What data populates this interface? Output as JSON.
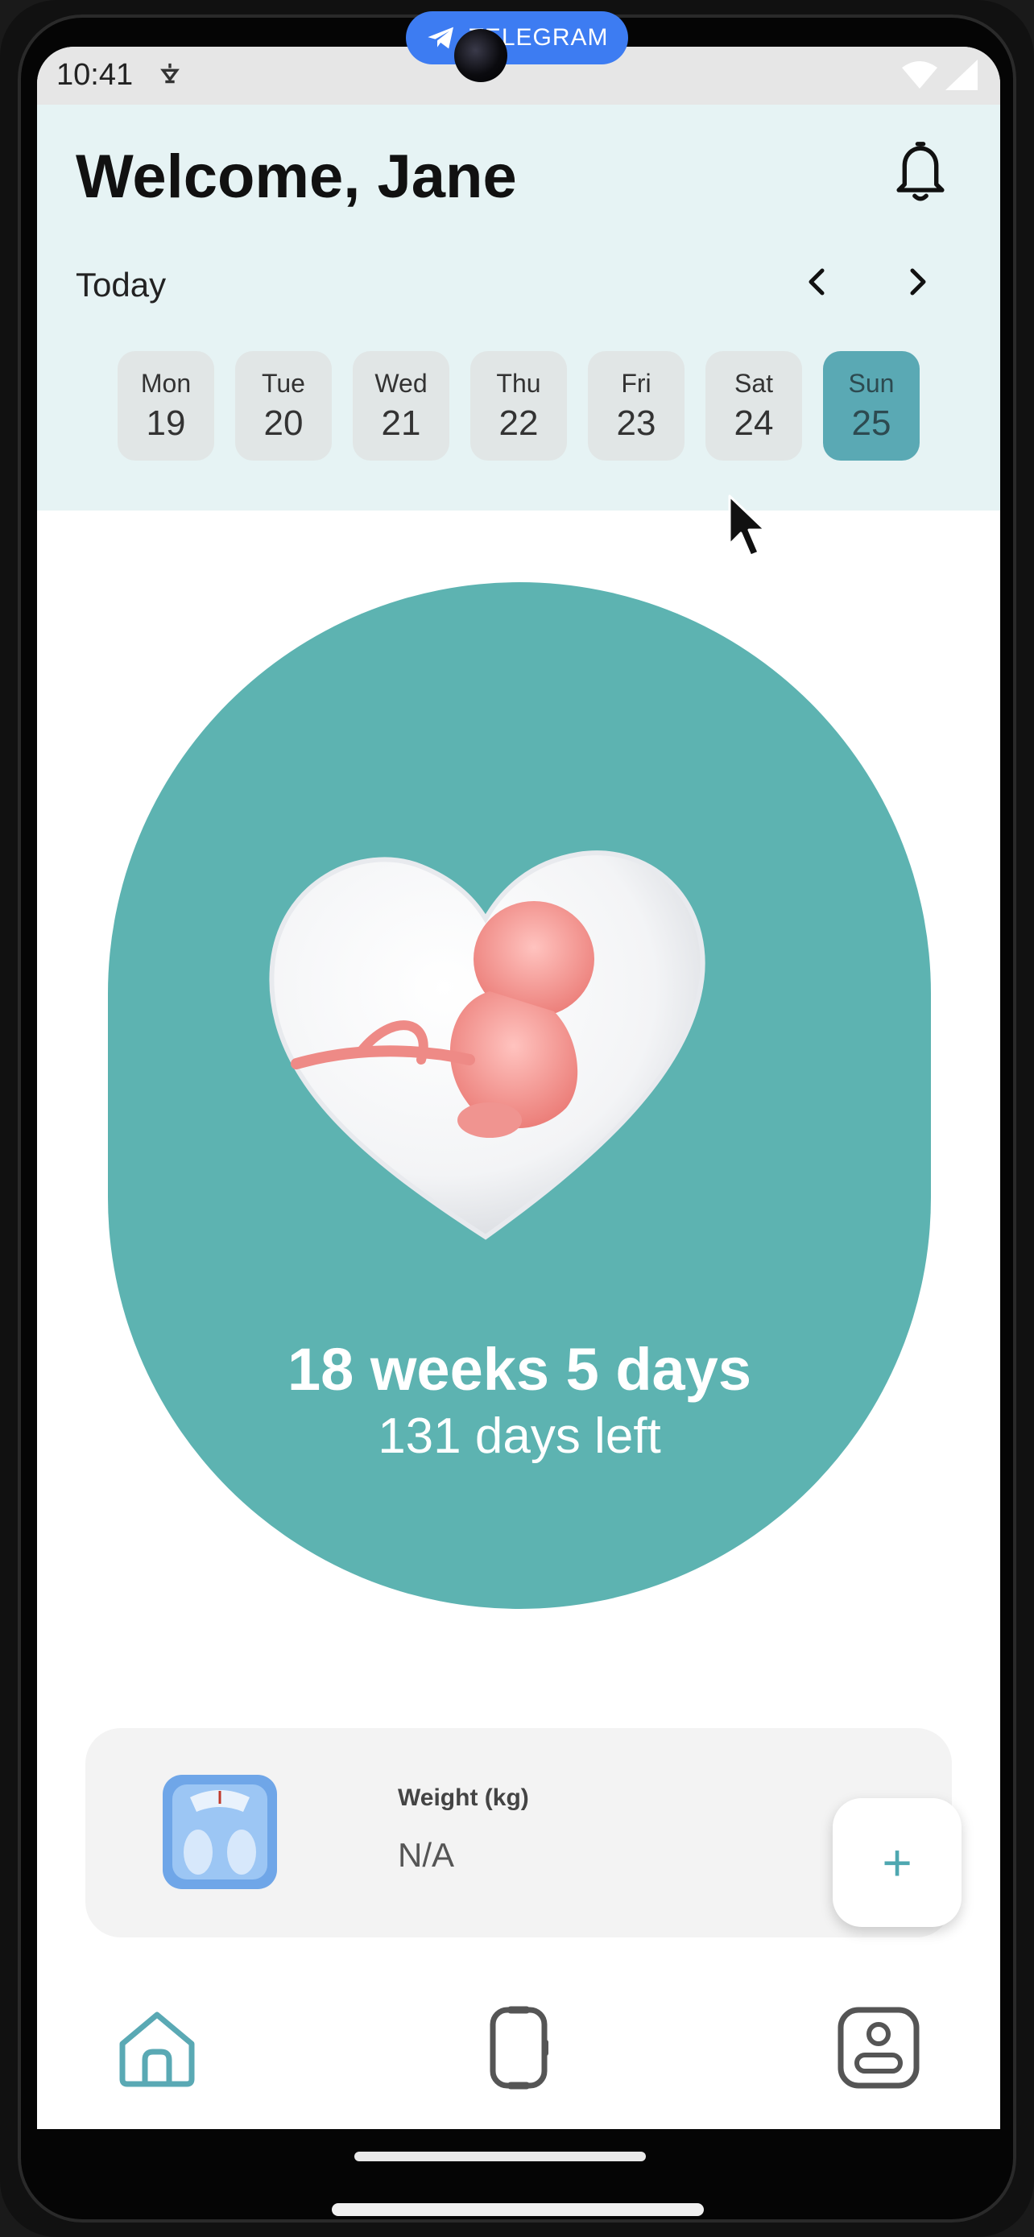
{
  "overlay": {
    "telegram_label": "TELEGRAM"
  },
  "status_bar": {
    "time": "10:41"
  },
  "header": {
    "welcome": "Welcome, Jane",
    "today_label": "Today",
    "days": [
      {
        "name": "Mon",
        "date": "19",
        "selected": false
      },
      {
        "name": "Tue",
        "date": "20",
        "selected": false
      },
      {
        "name": "Wed",
        "date": "21",
        "selected": false
      },
      {
        "name": "Thu",
        "date": "22",
        "selected": false
      },
      {
        "name": "Fri",
        "date": "23",
        "selected": false
      },
      {
        "name": "Sat",
        "date": "24",
        "selected": false
      },
      {
        "name": "Sun",
        "date": "25",
        "selected": true
      }
    ]
  },
  "pregnancy": {
    "weeks_text": "18 weeks 5 days",
    "days_left_text": "131 days left"
  },
  "weight_card": {
    "label": "Weight (kg)",
    "value": "N/A",
    "add_label": "+"
  },
  "colors": {
    "accent": "#5db3b1",
    "header_bg": "#e6f3f4",
    "selected_day": "#5aa9b4"
  },
  "icons": {
    "notification": "bell-icon",
    "prev": "chevron-left-icon",
    "next": "chevron-right-icon",
    "weight": "scale-icon",
    "nav": [
      "home-icon",
      "watch-icon",
      "profile-icon"
    ]
  }
}
